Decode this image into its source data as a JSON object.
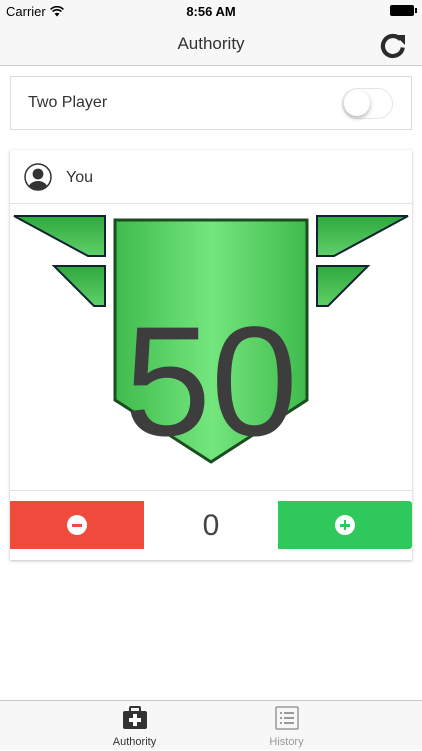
{
  "status_bar": {
    "carrier": "Carrier",
    "time": "8:56 AM"
  },
  "nav": {
    "title": "Authority",
    "refresh_icon": "refresh-icon"
  },
  "two_player": {
    "label": "Two Player",
    "enabled": false
  },
  "player": {
    "name": "You",
    "authority": "50",
    "delta": "0",
    "minus_icon": "minus-circle-icon",
    "plus_icon": "plus-circle-icon"
  },
  "tabs": [
    {
      "label": "Authority",
      "icon": "medkit-icon",
      "active": true
    },
    {
      "label": "History",
      "icon": "list-icon",
      "active": false
    }
  ],
  "colors": {
    "minus": "#ef4a3c",
    "plus": "#2fc85a",
    "shield_green": "#5fd06a",
    "shield_dark": "#1f8a2e"
  }
}
